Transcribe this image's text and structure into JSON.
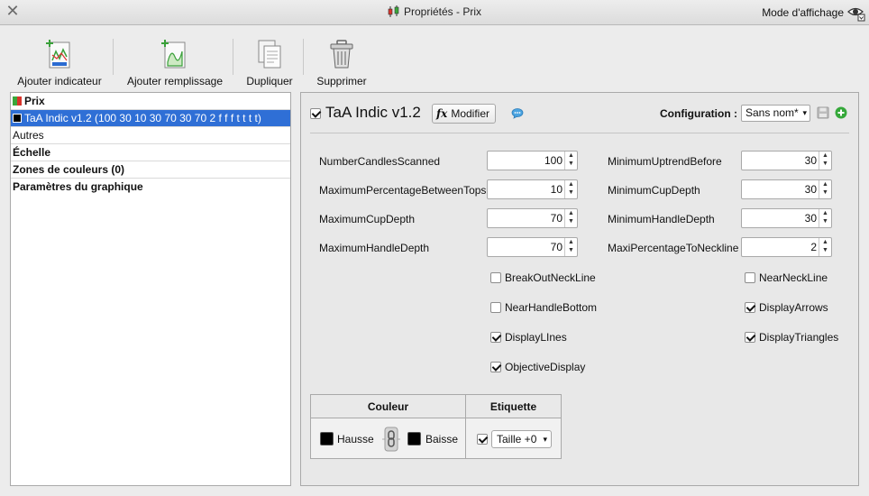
{
  "window": {
    "title": "Propriétés - Prix",
    "mode_label": "Mode d'affichage"
  },
  "toolbar": {
    "add_indicator": "Ajouter indicateur",
    "add_fill": "Ajouter remplissage",
    "duplicate": "Dupliquer",
    "delete": "Supprimer"
  },
  "tree": {
    "items": [
      {
        "label": "Prix",
        "bold": true
      },
      {
        "label": "TaA Indic v1.2 (100 30 10 30 70 30 70 2 f f f t t t t)",
        "selected": true
      },
      {
        "label": "Autres"
      },
      {
        "label": "Échelle",
        "bold": true
      },
      {
        "label": "Zones de couleurs (0)",
        "bold": true
      },
      {
        "label": "Paramètres du graphique",
        "bold": true
      }
    ]
  },
  "indicator": {
    "enabled": true,
    "title": "TaA Indic v1.2",
    "modify_label": "Modifier",
    "config_label": "Configuration :",
    "config_value": "Sans nom*"
  },
  "params_left": [
    {
      "label": "NumberCandlesScanned",
      "value": "100"
    },
    {
      "label": "MaximumPercentageBetweenTops",
      "value": "10"
    },
    {
      "label": "MaximumCupDepth",
      "value": "70"
    },
    {
      "label": "MaximumHandleDepth",
      "value": "70"
    }
  ],
  "params_right": [
    {
      "label": "MinimumUptrendBefore",
      "value": "30"
    },
    {
      "label": "MinimumCupDepth",
      "value": "30"
    },
    {
      "label": "MinimumHandleDepth",
      "value": "30"
    },
    {
      "label": "MaxiPercentageToNeckline",
      "value": "2"
    }
  ],
  "checks_left": [
    {
      "label": "BreakOutNeckLine",
      "checked": false
    },
    {
      "label": "NearHandleBottom",
      "checked": false
    },
    {
      "label": "DisplayLInes",
      "checked": true
    },
    {
      "label": "ObjectiveDisplay",
      "checked": true
    }
  ],
  "checks_right": [
    {
      "label": "NearNeckLine",
      "checked": false
    },
    {
      "label": "DisplayArrows",
      "checked": true
    },
    {
      "label": "DisplayTriangles",
      "checked": true
    }
  ],
  "style_table": {
    "color_header": "Couleur",
    "label_header": "Etiquette",
    "up_label": "Hausse",
    "down_label": "Baisse",
    "up_color": "#000000",
    "down_color": "#000000",
    "label_checked": true,
    "size_value": "Taille +0"
  },
  "colors": {
    "selection": "#2f6fd6",
    "add_green": "#35a83a"
  }
}
